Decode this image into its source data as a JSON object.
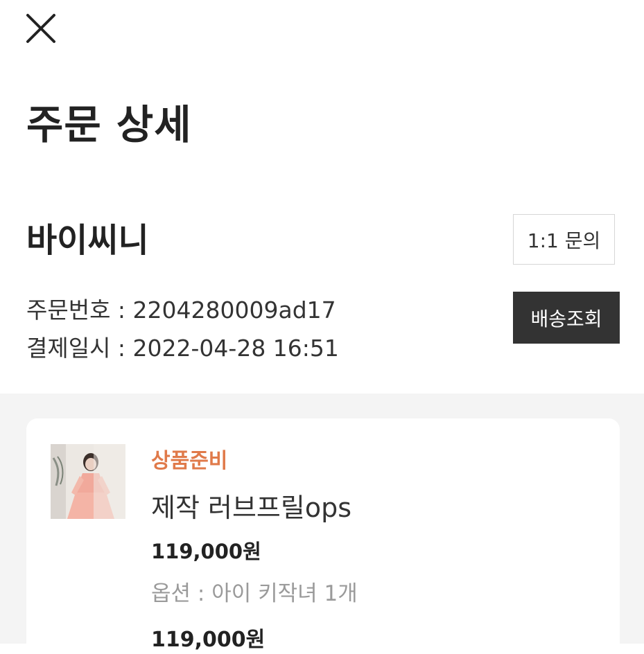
{
  "header": {
    "close_icon": "close-icon",
    "title": "주문 상세"
  },
  "order": {
    "seller": "바이씨니",
    "inquiry_label": "1:1 문의",
    "track_label": "배송조회",
    "order_number_line": "주문번호 : 2204280009ad17",
    "payment_date_line": "결제일시 : 2022-04-28 16:51"
  },
  "item": {
    "status": "상품준비",
    "status_color": "#e07a4a",
    "name": "제작 러브프릴ops",
    "price": "119,000원",
    "option": "옵션 : 아이 키작녀 1개",
    "total": "119,000원"
  },
  "colors": {
    "track_button_bg": "#333333",
    "section_bg": "#f4f4f4"
  }
}
